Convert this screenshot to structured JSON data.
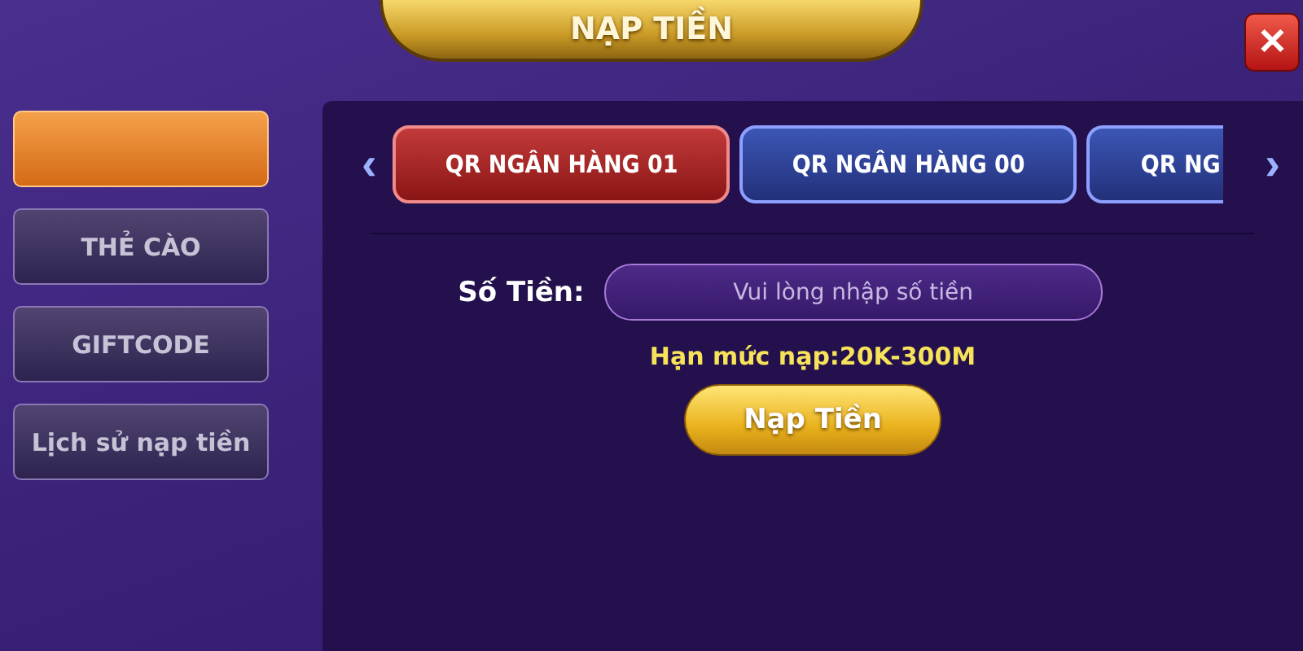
{
  "title": "NẠP TIỀN",
  "close": "✕",
  "sidebar": {
    "items": [
      {
        "selected": true
      },
      {
        "label": "THẺ CÀO",
        "selected": false
      },
      {
        "label": "GIFTCODE",
        "selected": false
      },
      {
        "label": "Lịch sử nạp tiền",
        "selected": false
      }
    ]
  },
  "tabs": {
    "prev": "‹",
    "next": "›",
    "items": [
      {
        "label": "QR NGÂN HÀNG 01",
        "selected": true
      },
      {
        "label": "QR NGÂN HÀNG 00",
        "selected": false
      },
      {
        "label": "QR NG",
        "selected": false
      }
    ]
  },
  "form": {
    "label": "Số Tiền:",
    "placeholder": "Vui lòng nhập số tiền",
    "limit": "Hạn mức nạp:20K-300M",
    "submit": "Nạp Tiền"
  }
}
